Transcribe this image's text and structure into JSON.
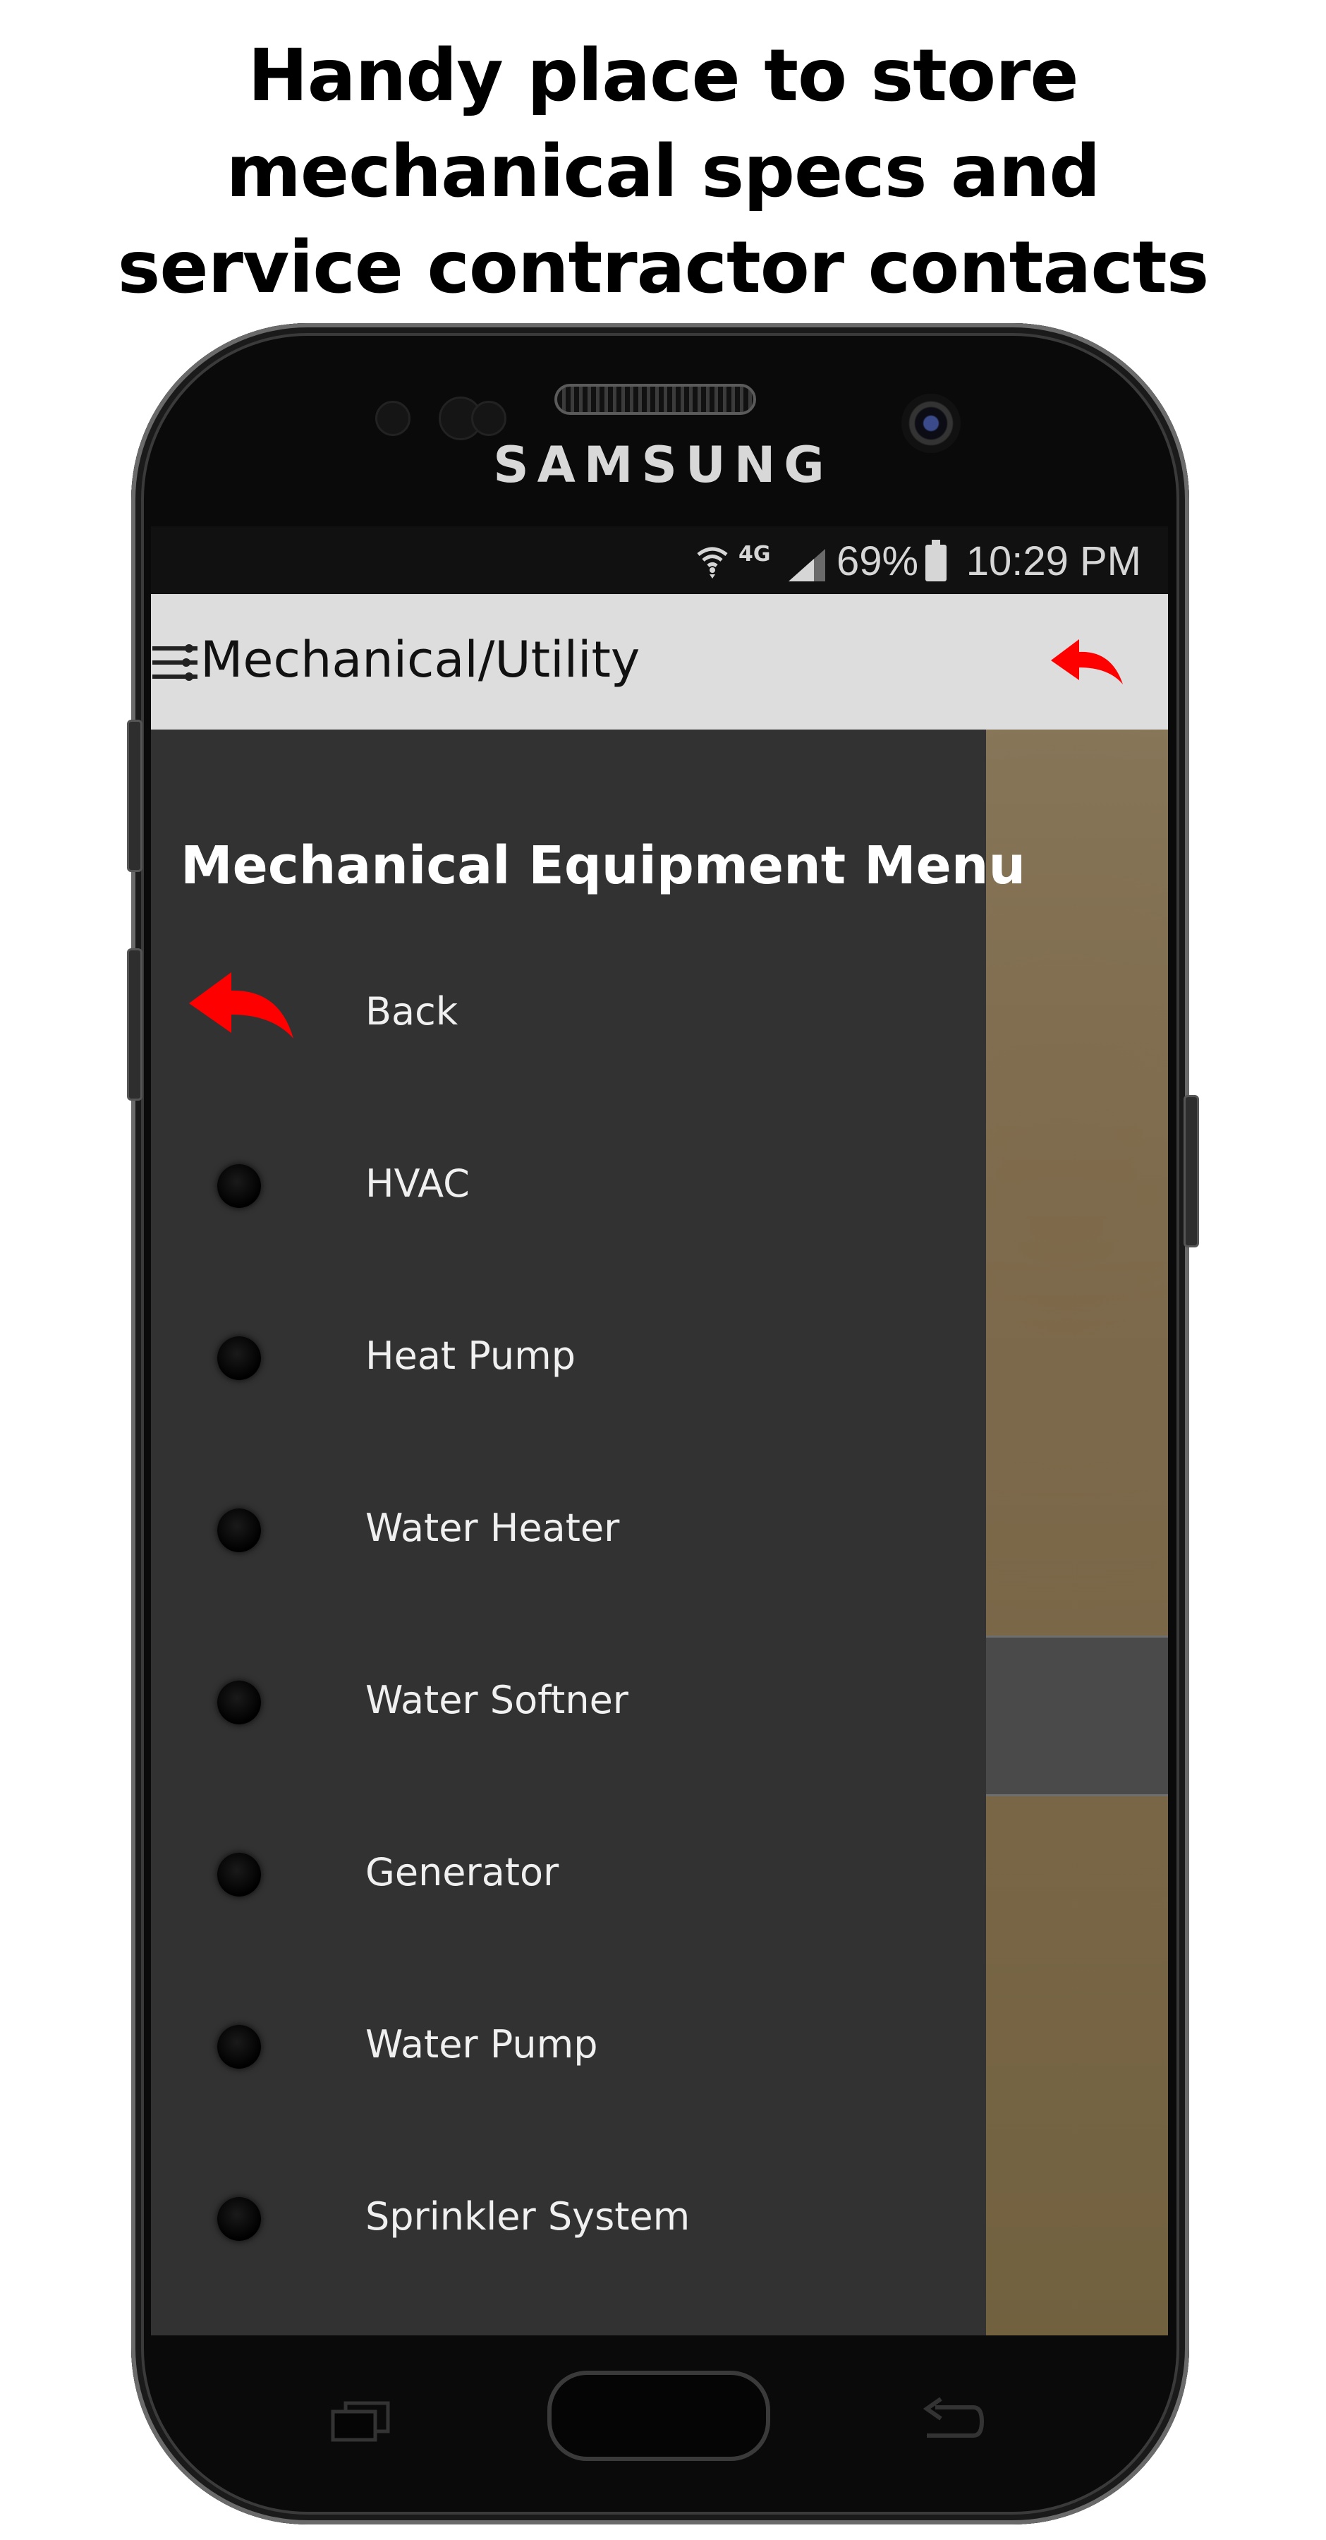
{
  "headline": {
    "line1": "Handy place to store",
    "line2": "mechanical specs and",
    "line3": "service contractor contacts"
  },
  "device": {
    "brand": "SAMSUNG"
  },
  "status_bar": {
    "network": "4G",
    "battery_percent": "69%",
    "time": "10:29 PM",
    "icons": [
      "wifi-icon",
      "signal-icon",
      "battery-icon"
    ]
  },
  "app_bar": {
    "title": "Mechanical/Utility",
    "menu_icon": "hamburger-menu-icon",
    "back_icon": "red-back-arrow-icon"
  },
  "drawer": {
    "title": "Mechanical Equipment Menu",
    "items": [
      {
        "label": "Back",
        "icon": "red-back-arrow-icon"
      },
      {
        "label": "HVAC",
        "icon": "bullet-dot-icon"
      },
      {
        "label": "Heat Pump",
        "icon": "bullet-dot-icon"
      },
      {
        "label": "Water Heater",
        "icon": "bullet-dot-icon"
      },
      {
        "label": "Water Softner",
        "icon": "bullet-dot-icon"
      },
      {
        "label": "Generator",
        "icon": "bullet-dot-icon"
      },
      {
        "label": "Water Pump",
        "icon": "bullet-dot-icon"
      },
      {
        "label": "Sprinkler System",
        "icon": "bullet-dot-icon"
      }
    ]
  },
  "colors": {
    "accent_red": "#ff0000",
    "drawer_bg": "#323232",
    "app_bar_bg": "#dddddd"
  }
}
